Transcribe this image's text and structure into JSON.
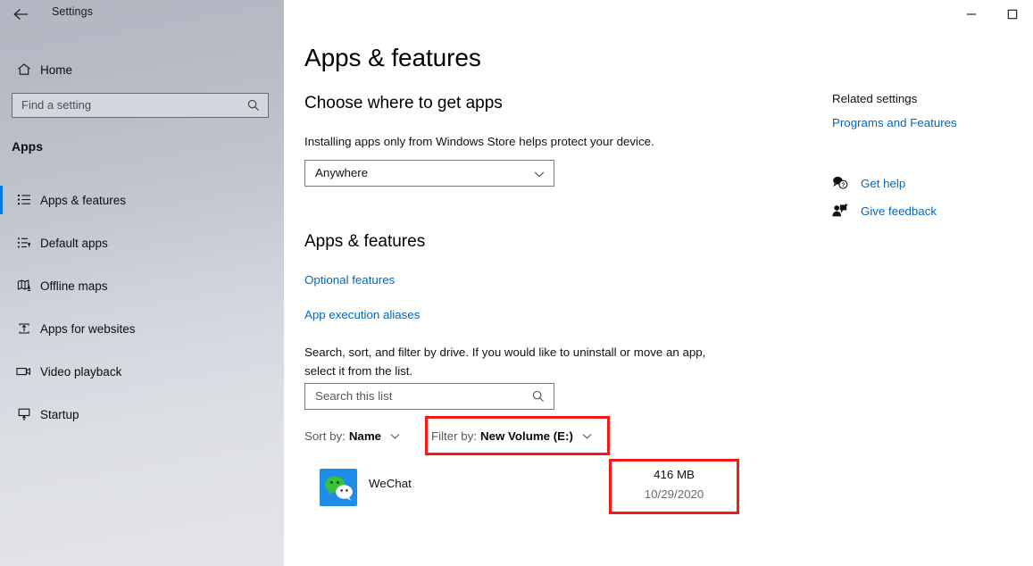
{
  "window": {
    "title": "Settings",
    "back_icon": "back-arrow-icon",
    "controls": [
      {
        "name": "minimize",
        "glyph": "—"
      },
      {
        "name": "maximize",
        "glyph": "□"
      }
    ]
  },
  "sidebar": {
    "search": {
      "placeholder": "Find a setting",
      "icon": "search-icon"
    },
    "home": {
      "label": "Home",
      "icon": "home-icon"
    },
    "category": "Apps",
    "items": [
      {
        "label": "Apps & features",
        "icon": "list-icon",
        "selected": true
      },
      {
        "label": "Default apps",
        "icon": "default-apps-icon",
        "selected": false
      },
      {
        "label": "Offline maps",
        "icon": "map-download-icon",
        "selected": false
      },
      {
        "label": "Apps for websites",
        "icon": "box-arrow-up-icon",
        "selected": false
      },
      {
        "label": "Video playback",
        "icon": "video-camera-icon",
        "selected": false
      },
      {
        "label": "Startup",
        "icon": "monitor-arrow-up-icon",
        "selected": false
      }
    ]
  },
  "main": {
    "page_title": "Apps & features",
    "choose_heading": "Choose where to get apps",
    "install_description": "Installing apps only from Windows Store helps protect your device.",
    "source_select": {
      "value": "Anywhere",
      "chevron": "chevron-down-icon"
    },
    "section_heading": "Apps & features",
    "optional_features_link": "Optional features",
    "execution_aliases_link": "App execution aliases",
    "list_description": "Search, sort, and filter by drive. If you would like to uninstall or move an app, select it from the list.",
    "search_list": {
      "placeholder": "Search this list",
      "icon": "search-icon"
    },
    "sort_by": {
      "label": "Sort by:",
      "value": "Name",
      "chevron": "chevron-down-icon"
    },
    "filter_by": {
      "label": "Filter by:",
      "value": "New Volume (E:)",
      "chevron": "chevron-down-icon",
      "highlighted": true
    },
    "apps": [
      {
        "name": "WeChat",
        "icon": "wechat-icon",
        "size": "416 MB",
        "date": "10/29/2020",
        "highlighted": true
      }
    ]
  },
  "right_panel": {
    "related_settings_title": "Related settings",
    "programs_and_features_link": "Programs and Features",
    "get_help": {
      "label": "Get help",
      "icon": "help-bubble-icon"
    },
    "give_feedback": {
      "label": "Give feedback",
      "icon": "feedback-person-icon"
    }
  },
  "colors": {
    "accent_blue": "#0078d7",
    "link_blue": "#0067c0",
    "highlight_red": "#f41b1b",
    "wechat_blue": "#1f8ce8",
    "wechat_green": "#3ac13a"
  }
}
